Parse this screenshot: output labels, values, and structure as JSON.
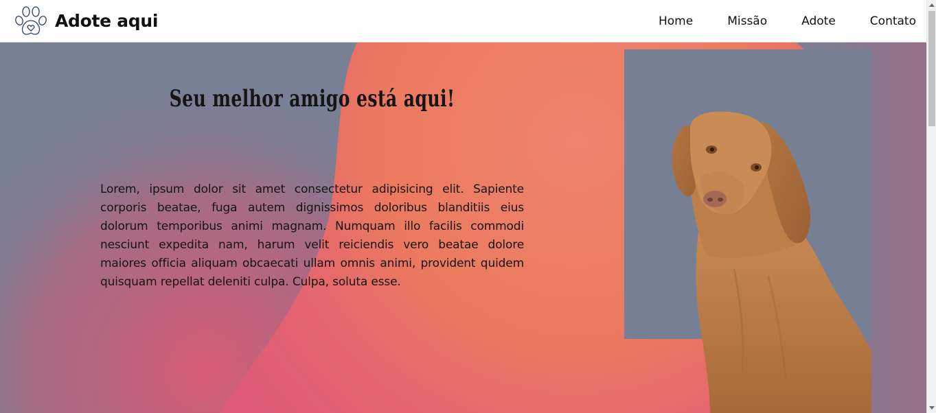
{
  "brand": {
    "name": "Adote aqui",
    "logo_icon": "paw-heart-icon"
  },
  "nav": {
    "items": [
      "Home",
      "Missão",
      "Adote",
      "Contato"
    ]
  },
  "hero": {
    "title": "Seu melhor amigo está aqui!",
    "text": "Lorem, ipsum dolor sit amet consectetur adipisicing elit. Sapiente corporis beatae, fuga autem dignissimos doloribus blanditiis eius dolorum temporibus animi magnam. Numquam illo facilis commodi nesciunt expedita nam, harum velit reiciendis vero beatae dolore maiores officia aliquam obcaecati ullam omnis animi, provident quidem quisquam repellat deleniti culpa. Culpa, soluta esse.",
    "image": "dog-photo"
  },
  "colors": {
    "background_slate": "#788095",
    "gradient_coral": "#ec7a5e",
    "gradient_pink": "#e05a78",
    "photo_box": "#777f95"
  }
}
